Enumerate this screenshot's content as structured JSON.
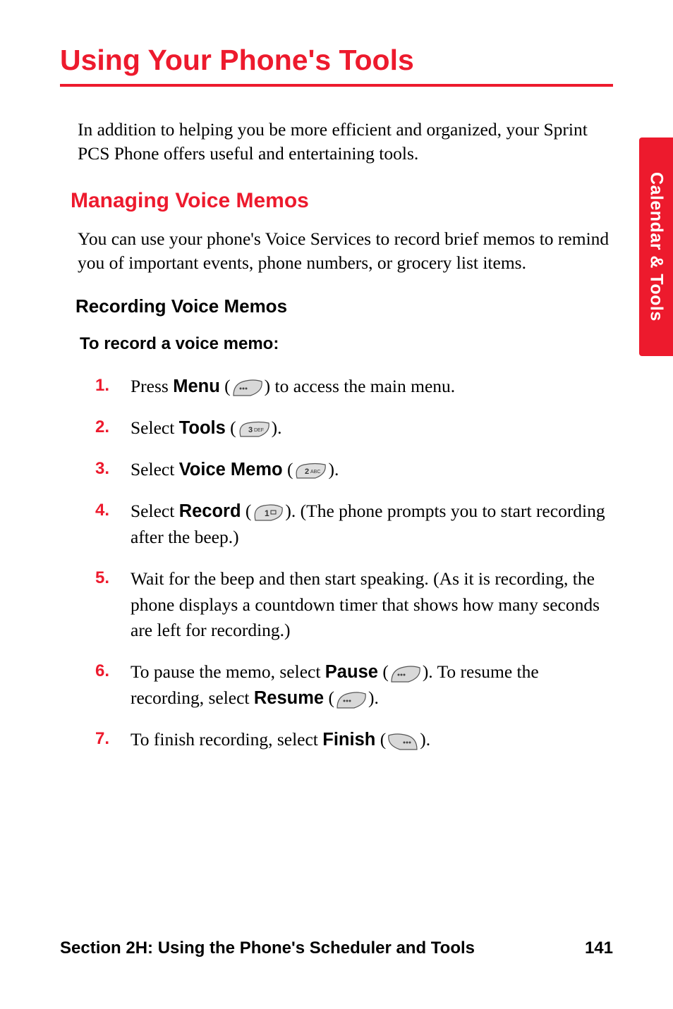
{
  "title": "Using Your Phone's Tools",
  "intro": "In addition to helping you be more efficient and organized, your Sprint PCS Phone offers useful and entertaining tools.",
  "section_heading": "Managing Voice Memos",
  "section_body": "You can use your phone's Voice Services to record brief memos to remind you of important events, phone numbers, or grocery list items.",
  "sub_heading": "Recording Voice Memos",
  "lead": "To record a voice memo:",
  "steps": {
    "s1_a": "Press ",
    "s1_menu": "Menu",
    "s1_b": " (",
    "s1_c": ") to access the main menu.",
    "s2_a": "Select ",
    "s2_tools": "Tools",
    "s2_b": " (",
    "s2_c": ").",
    "s3_a": "Select ",
    "s3_vm": "Voice Memo",
    "s3_b": " (",
    "s3_c": ").",
    "s4_a": "Select ",
    "s4_record": "Record",
    "s4_b": " (",
    "s4_c": "). (The phone prompts you to start recording after the beep.)",
    "s5": "Wait for the beep and then start speaking. (As it is recording, the phone displays a countdown timer that shows how many seconds are left for recording.)",
    "s6_a": "To pause the memo, select ",
    "s6_pause": "Pause",
    "s6_b": " (",
    "s6_c": "). To resume the recording, select ",
    "s6_resume": "Resume",
    "s6_d": " (",
    "s6_e": ").",
    "s7_a": "To finish recording, select ",
    "s7_finish": "Finish",
    "s7_b": " (",
    "s7_c": ")."
  },
  "side_tab": "Calendar & Tools",
  "footer_left": "Section 2H: Using the Phone's Scheduler and Tools",
  "footer_page": "141",
  "icons": {
    "left_softkey": "left-softkey-icon",
    "right_softkey": "right-softkey-icon",
    "key_1": "key-1-icon",
    "key_2abc": "key-2abc-icon",
    "key_3def": "key-3def-icon"
  }
}
